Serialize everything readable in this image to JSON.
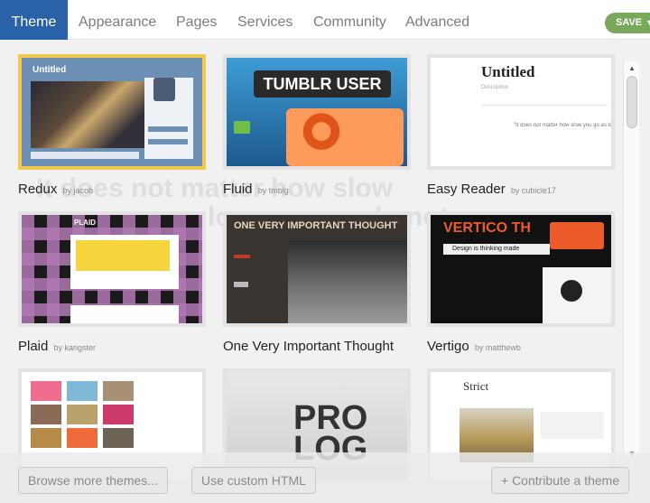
{
  "tabs": [
    "Theme",
    "Appearance",
    "Pages",
    "Services",
    "Community",
    "Advanced"
  ],
  "save_button": {
    "label": "SAVE",
    "icon": "chevron-down-icon"
  },
  "ghost_text": {
    "line1": "It does not matter how slow",
    "line2": "long as you do not"
  },
  "themes": [
    {
      "name": "Redux",
      "by": "by jacob",
      "selected": true,
      "thumb_title": "Untitled"
    },
    {
      "name": "Fluid",
      "by": "by tmblg",
      "selected": false,
      "thumb_title": "TUMBLR USER"
    },
    {
      "name": "Easy Reader",
      "by": "by cubicle17",
      "selected": false,
      "thumb_title": "Untitled",
      "thumb_sub": "Description",
      "thumb_quote": "\"It does not matter how slow you go as lo"
    },
    {
      "name": "Plaid",
      "by": "by kangster",
      "selected": false,
      "thumb_title": "PLAID"
    },
    {
      "name": "One Very Important Thought",
      "by": "",
      "selected": false,
      "thumb_title": "ONE VERY IMPORTANT THOUGHT"
    },
    {
      "name": "Vertigo",
      "by": "by matthewb",
      "selected": false,
      "thumb_title": "VERTICO TH",
      "thumb_sub": "Design is thinking made"
    },
    {
      "name": "",
      "by": "",
      "selected": false
    },
    {
      "name": "",
      "by": "",
      "selected": false,
      "thumb_title": "PRO LOG"
    },
    {
      "name": "",
      "by": "",
      "selected": false,
      "thumb_title": "Strict"
    }
  ],
  "buttons": {
    "browse": "Browse more themes...",
    "custom_html": "Use custom HTML",
    "contribute": "+ Contribute a theme"
  },
  "colors": {
    "active_tab": "#2a62a8",
    "save": "#79a85c",
    "selected_border": "#f2c94c"
  }
}
